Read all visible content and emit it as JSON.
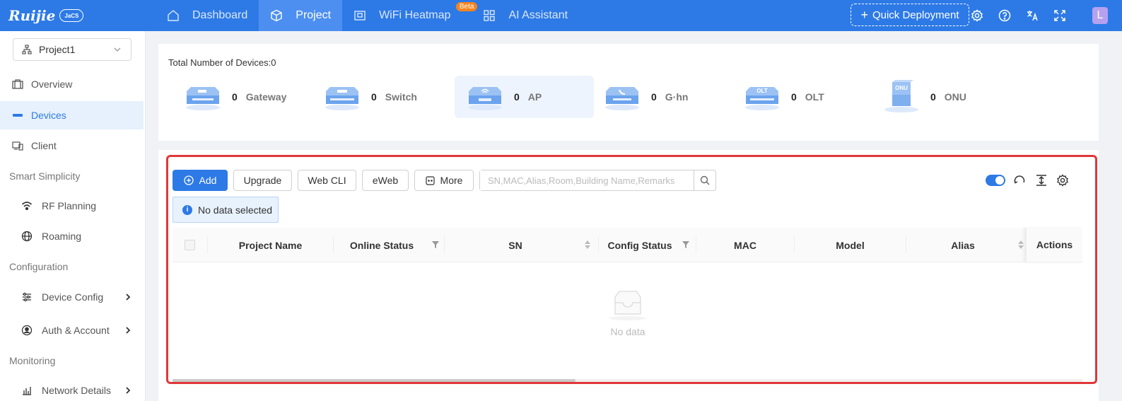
{
  "brand": {
    "name": "Ruijie",
    "product": "JaCS"
  },
  "nav": {
    "items": [
      {
        "label": "Dashboard",
        "icon": "home-icon"
      },
      {
        "label": "Project",
        "icon": "cube-icon",
        "active": true
      },
      {
        "label": "WiFi Heatmap",
        "icon": "heatmap-icon",
        "badge": "Beta"
      },
      {
        "label": "AI Assistant",
        "icon": "grid-icon"
      }
    ],
    "quick_deployment": "Quick Deployment",
    "avatar_letter": "L"
  },
  "sidebar": {
    "project": "Project1",
    "items": {
      "overview": "Overview",
      "devices": "Devices",
      "client": "Client",
      "group_smart": "Smart Simplicity",
      "rf_planning": "RF Planning",
      "roaming": "Roaming",
      "group_config": "Configuration",
      "device_config": "Device Config",
      "auth_account": "Auth & Account",
      "group_monitoring": "Monitoring",
      "network_details": "Network Details"
    }
  },
  "summary": {
    "total_label": "Total Number of Devices:0",
    "devices": [
      {
        "count": "0",
        "label": "Gateway"
      },
      {
        "count": "0",
        "label": "Switch"
      },
      {
        "count": "0",
        "label": "AP",
        "selected": true
      },
      {
        "count": "0",
        "label": "G·hn"
      },
      {
        "count": "0",
        "label": "OLT"
      },
      {
        "count": "0",
        "label": "ONU"
      }
    ]
  },
  "toolbar": {
    "add": "Add",
    "upgrade": "Upgrade",
    "web_cli": "Web CLI",
    "eweb": "eWeb",
    "more": "More",
    "search_placeholder": "SN,MAC,Alias,Room,Building Name,Remarks"
  },
  "selection_info": "No data selected",
  "table": {
    "columns": [
      "Project Name",
      "Online Status",
      "SN",
      "Config Status",
      "MAC",
      "Model",
      "Alias",
      "Actions"
    ],
    "empty_text": "No data"
  },
  "colors": {
    "primary": "#2d7ae6",
    "highlight": "#e0383a",
    "beta": "#f7841d"
  }
}
